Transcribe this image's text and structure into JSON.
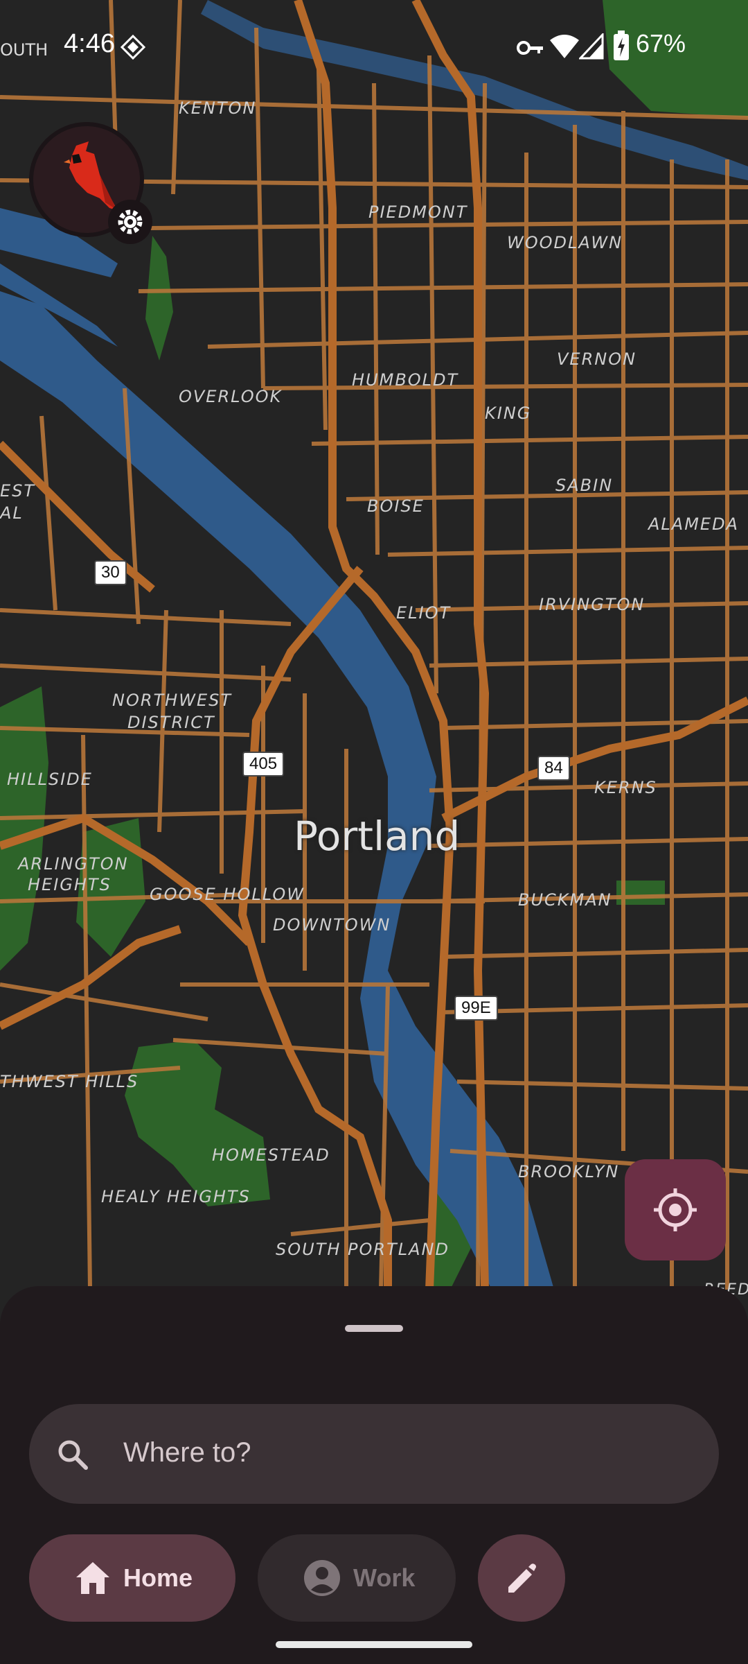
{
  "status_bar": {
    "time": "4:46",
    "edge_label": "OUTH",
    "battery": "67%"
  },
  "map": {
    "city_label": "Portland",
    "neighborhoods": [
      "KENTON",
      "PIEDMONT",
      "WOODLAWN",
      "VERNON",
      "HUMBOLDT",
      "OVERLOOK",
      "KING",
      "SABIN",
      "ALAMEDA",
      "BOISE",
      "ELIOT",
      "IRVINGTON",
      "NORTHWEST",
      "DISTRICT",
      "HILLSIDE",
      "KERNS",
      "ARLINGTON",
      "HEIGHTS",
      "GOOSE HOLLOW",
      "DOWNTOWN",
      "BUCKMAN",
      "THWEST HILLS",
      "HOMESTEAD",
      "HEALY HEIGHTS",
      "BROOKLYN",
      "SOUTH PORTLAND",
      "EST",
      "AL",
      "REED"
    ],
    "route_shields": [
      "30",
      "405",
      "84",
      "99E"
    ],
    "colors": {
      "road": "#b7763a",
      "water": "#2f5a8a",
      "park": "#2f6b2a",
      "land": "#242424"
    }
  },
  "profile": {
    "icon": "cardinal-bird-icon",
    "settings_icon": "gear-icon"
  },
  "locate_button": {
    "icon": "locate-icon",
    "color": "#6b2f45"
  },
  "bottom_sheet": {
    "search": {
      "placeholder": "Where to?",
      "icon": "search-icon"
    },
    "chips": {
      "home": {
        "label": "Home",
        "icon": "home-icon"
      },
      "work": {
        "label": "Work",
        "icon": "person-icon"
      },
      "edit": {
        "icon": "pencil-icon"
      }
    }
  }
}
